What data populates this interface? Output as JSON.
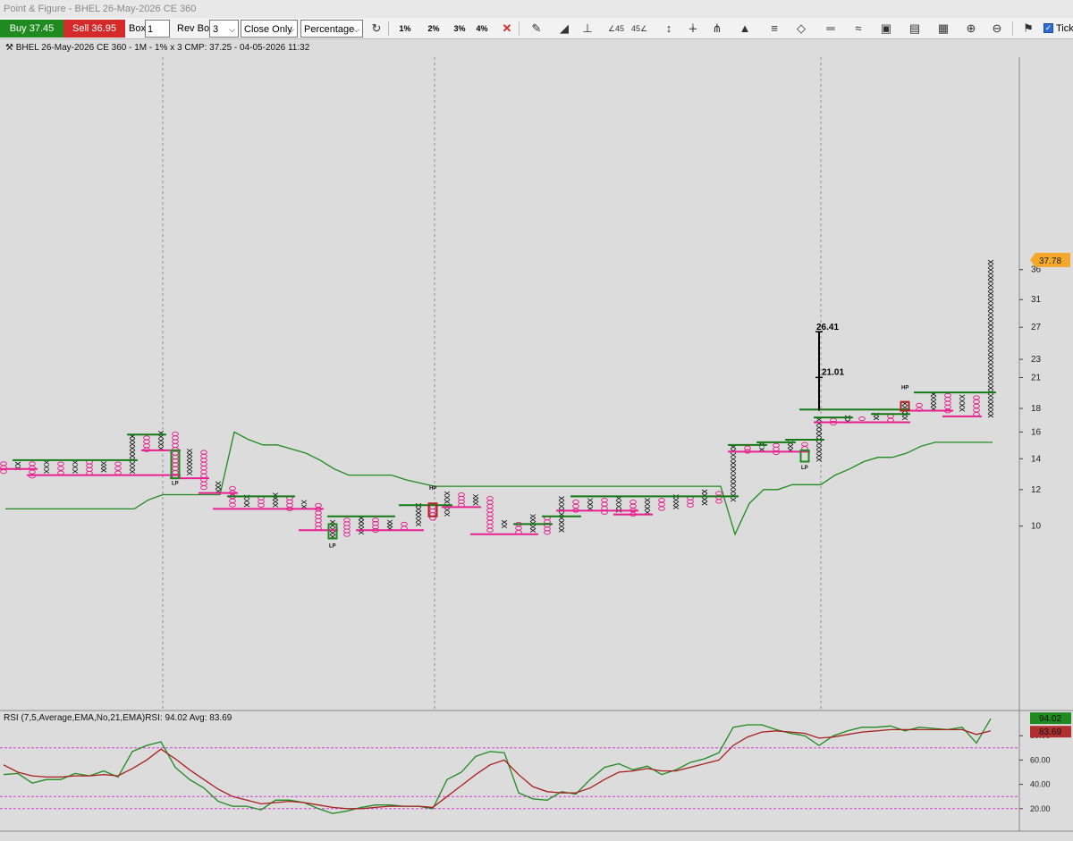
{
  "window_title": "Point & Figure - BHEL 26-May-2026 CE 360",
  "toolbar": {
    "buy_label": "Buy 37.45",
    "sell_label": "Sell 36.95",
    "box_label": "Box",
    "box_value": "1",
    "rev_box_label": "Rev Box",
    "rev_box_value": "3",
    "price_mode": "Close Only",
    "box_type": "Percentage",
    "pct_buttons": [
      "1%",
      "2%",
      "3%",
      "4%"
    ],
    "tick_label": "Tick",
    "icons": [
      "refresh-icon",
      "close-x-icon",
      "pencil-icon",
      "triangle-icon",
      "anchor-icon",
      "angle-45-left-icon",
      "angle-45-right-icon",
      "vertical-line-icon",
      "vertical-line-2-icon",
      "fork-icon",
      "megaphone-icon",
      "bars-icon",
      "diamond-icon",
      "horizontal-line-icon",
      "trend-line-icon",
      "rectangle-icon",
      "document-icon",
      "grid-icon",
      "zoom-in-icon",
      "zoom-out-icon",
      "pin-icon"
    ],
    "colors": {
      "buy": "#1f8a1f",
      "sell": "#d42a2a"
    }
  },
  "chart_data": [
    {
      "type": "point-and-figure",
      "title": "BHEL 26-May-2026 CE 360 - 1M - 1% x 3 CMP: 37.25 - 04-05-2026 11:32",
      "y_ticks": [
        10,
        12,
        14,
        16,
        18,
        21,
        23,
        27,
        31,
        36
      ],
      "last_price_label": "37.78",
      "columns": [
        {
          "kind": "O",
          "from": 13.0,
          "to": 13.8
        },
        {
          "kind": "X",
          "from": 13.2,
          "to": 13.8
        },
        {
          "kind": "O",
          "from": 12.7,
          "to": 13.8
        },
        {
          "kind": "X",
          "from": 13.0,
          "to": 13.9
        },
        {
          "kind": "O",
          "from": 12.9,
          "to": 13.8
        },
        {
          "kind": "X",
          "from": 13.0,
          "to": 13.9
        },
        {
          "kind": "O",
          "from": 12.9,
          "to": 13.9
        },
        {
          "kind": "X",
          "from": 13.1,
          "to": 13.8
        },
        {
          "kind": "O",
          "from": 12.9,
          "to": 13.8
        },
        {
          "kind": "X",
          "from": 13.0,
          "to": 15.8
        },
        {
          "kind": "O",
          "from": 14.5,
          "to": 15.7
        },
        {
          "kind": "X",
          "from": 14.6,
          "to": 16.1
        },
        {
          "kind": "O",
          "from": 12.7,
          "to": 16.0
        },
        {
          "kind": "X",
          "from": 12.9,
          "to": 14.7
        },
        {
          "kind": "O",
          "from": 12.0,
          "to": 14.6
        },
        {
          "kind": "X",
          "from": 11.8,
          "to": 12.5
        },
        {
          "kind": "O",
          "from": 11.0,
          "to": 12.2
        },
        {
          "kind": "X",
          "from": 11.0,
          "to": 11.7
        },
        {
          "kind": "O",
          "from": 11.0,
          "to": 11.6
        },
        {
          "kind": "X",
          "from": 11.0,
          "to": 11.8
        },
        {
          "kind": "O",
          "from": 10.8,
          "to": 11.6
        },
        {
          "kind": "X",
          "from": 10.9,
          "to": 11.4
        },
        {
          "kind": "O",
          "from": 9.8,
          "to": 11.2
        },
        {
          "kind": "X",
          "from": 9.4,
          "to": 10.3
        },
        {
          "kind": "O",
          "from": 9.5,
          "to": 10.4
        },
        {
          "kind": "X",
          "from": 9.6,
          "to": 10.5
        },
        {
          "kind": "O",
          "from": 9.7,
          "to": 10.4
        },
        {
          "kind": "X",
          "from": 9.8,
          "to": 10.3
        },
        {
          "kind": "O",
          "from": 9.8,
          "to": 10.2
        },
        {
          "kind": "X",
          "from": 10.0,
          "to": 11.2
        },
        {
          "kind": "O",
          "from": 10.3,
          "to": 11.1
        },
        {
          "kind": "X",
          "from": 10.5,
          "to": 11.9
        },
        {
          "kind": "O",
          "from": 11.0,
          "to": 11.8
        },
        {
          "kind": "X",
          "from": 11.1,
          "to": 11.7
        },
        {
          "kind": "O",
          "from": 9.7,
          "to": 11.6
        },
        {
          "kind": "X",
          "from": 9.9,
          "to": 10.3
        },
        {
          "kind": "O",
          "from": 9.6,
          "to": 10.2
        },
        {
          "kind": "X",
          "from": 9.7,
          "to": 10.6
        },
        {
          "kind": "O",
          "from": 9.6,
          "to": 10.5
        },
        {
          "kind": "X",
          "from": 9.7,
          "to": 11.6
        },
        {
          "kind": "O",
          "from": 10.7,
          "to": 11.4
        },
        {
          "kind": "X",
          "from": 10.8,
          "to": 11.5
        },
        {
          "kind": "O",
          "from": 10.6,
          "to": 11.5
        },
        {
          "kind": "X",
          "from": 10.7,
          "to": 11.6
        },
        {
          "kind": "O",
          "from": 10.5,
          "to": 11.4
        },
        {
          "kind": "X",
          "from": 10.6,
          "to": 11.5
        },
        {
          "kind": "O",
          "from": 10.8,
          "to": 11.5
        },
        {
          "kind": "X",
          "from": 10.9,
          "to": 11.7
        },
        {
          "kind": "O",
          "from": 11.0,
          "to": 11.6
        },
        {
          "kind": "X",
          "from": 11.1,
          "to": 12.0
        },
        {
          "kind": "O",
          "from": 11.2,
          "to": 11.9
        },
        {
          "kind": "X",
          "from": 11.3,
          "to": 15.0
        },
        {
          "kind": "O",
          "from": 14.4,
          "to": 14.9
        },
        {
          "kind": "X",
          "from": 14.5,
          "to": 15.2
        },
        {
          "kind": "O",
          "from": 14.3,
          "to": 15.1
        },
        {
          "kind": "X",
          "from": 14.5,
          "to": 15.3
        },
        {
          "kind": "O",
          "from": 14.6,
          "to": 15.2
        },
        {
          "kind": "X",
          "from": 13.8,
          "to": 17.2
        },
        {
          "kind": "O",
          "from": 16.6,
          "to": 17.1
        },
        {
          "kind": "X",
          "from": 16.7,
          "to": 17.4
        },
        {
          "kind": "O",
          "from": 16.9,
          "to": 17.3
        },
        {
          "kind": "X",
          "from": 17.0,
          "to": 17.6
        },
        {
          "kind": "O",
          "from": 16.8,
          "to": 17.5
        },
        {
          "kind": "X",
          "from": 17.0,
          "to": 18.6
        },
        {
          "kind": "O",
          "from": 17.7,
          "to": 18.5
        },
        {
          "kind": "X",
          "from": 17.8,
          "to": 19.5
        },
        {
          "kind": "O",
          "from": 17.6,
          "to": 19.4
        },
        {
          "kind": "X",
          "from": 17.7,
          "to": 19.3
        },
        {
          "kind": "O",
          "from": 17.3,
          "to": 19.2
        },
        {
          "kind": "X",
          "from": 17.2,
          "to": 37.78
        }
      ],
      "support_lines_green": [
        {
          "from": 1,
          "to": 9,
          "price": 13.9
        },
        {
          "from": 9,
          "to": 11,
          "price": 15.8
        },
        {
          "from": 16,
          "to": 20,
          "price": 11.6
        },
        {
          "from": 23,
          "to": 27,
          "price": 10.5
        },
        {
          "from": 28,
          "to": 31,
          "price": 11.1
        },
        {
          "from": 36,
          "to": 38,
          "price": 10.1
        },
        {
          "from": 38,
          "to": 40,
          "price": 10.5
        },
        {
          "from": 40,
          "to": 51,
          "price": 11.6
        },
        {
          "from": 51,
          "to": 53,
          "price": 15.0
        },
        {
          "from": 53,
          "to": 55,
          "price": 15.2
        },
        {
          "from": 55,
          "to": 57,
          "price": 15.4
        },
        {
          "from": 57,
          "to": 59,
          "price": 17.2
        },
        {
          "from": 56,
          "to": 63,
          "price": 17.9
        },
        {
          "from": 61,
          "to": 63,
          "price": 17.5
        },
        {
          "from": 64,
          "to": 69,
          "price": 19.5
        }
      ],
      "resistance_lines_pink": [
        {
          "from": 0,
          "to": 2,
          "price": 13.3
        },
        {
          "from": 2,
          "to": 12,
          "price": 12.9
        },
        {
          "from": 10,
          "to": 12,
          "price": 14.6
        },
        {
          "from": 12,
          "to": 14,
          "price": 12.7
        },
        {
          "from": 14,
          "to": 16,
          "price": 11.8
        },
        {
          "from": 15,
          "to": 22,
          "price": 10.9
        },
        {
          "from": 21,
          "to": 23,
          "price": 9.8
        },
        {
          "from": 25,
          "to": 29,
          "price": 9.8
        },
        {
          "from": 31,
          "to": 33,
          "price": 11.0
        },
        {
          "from": 33,
          "to": 37,
          "price": 9.6
        },
        {
          "from": 39,
          "to": 44,
          "price": 10.8
        },
        {
          "from": 43,
          "to": 45,
          "price": 10.6
        },
        {
          "from": 51,
          "to": 56,
          "price": 14.5
        },
        {
          "from": 57,
          "to": 63,
          "price": 16.8
        },
        {
          "from": 63,
          "to": 66,
          "price": 17.8
        },
        {
          "from": 66,
          "to": 68,
          "price": 17.3
        }
      ],
      "pattern_boxes": [
        {
          "col": 12,
          "from": 12.7,
          "to": 14.6,
          "color": "#1f8a1f"
        },
        {
          "col": 23,
          "from": 9.4,
          "to": 10.1,
          "color": "#1f8a1f"
        },
        {
          "col": 30,
          "from": 10.5,
          "to": 11.2,
          "color": "#b22222"
        },
        {
          "col": 56,
          "from": 13.8,
          "to": 14.6,
          "color": "#1f8a1f"
        },
        {
          "col": 63,
          "from": 17.8,
          "to": 18.6,
          "color": "#b22222"
        }
      ],
      "moving_average": [
        {
          "x": 0,
          "price": 10.9
        },
        {
          "x": 9,
          "price": 10.9
        },
        {
          "x": 10,
          "price": 11.4
        },
        {
          "x": 11,
          "price": 11.7
        },
        {
          "x": 15,
          "price": 11.7
        },
        {
          "x": 16,
          "price": 16.0
        },
        {
          "x": 17,
          "price": 15.4
        },
        {
          "x": 18,
          "price": 15.0
        },
        {
          "x": 19,
          "price": 15.0
        },
        {
          "x": 20,
          "price": 14.7
        },
        {
          "x": 21,
          "price": 14.4
        },
        {
          "x": 22,
          "price": 13.9
        },
        {
          "x": 23,
          "price": 13.3
        },
        {
          "x": 24,
          "price": 12.9
        },
        {
          "x": 27,
          "price": 12.9
        },
        {
          "x": 28,
          "price": 12.6
        },
        {
          "x": 29,
          "price": 12.4
        },
        {
          "x": 30,
          "price": 12.2
        },
        {
          "x": 50,
          "price": 12.2
        },
        {
          "x": 51,
          "price": 9.6
        },
        {
          "x": 52,
          "price": 11.2
        },
        {
          "x": 53,
          "price": 12.0
        },
        {
          "x": 54,
          "price": 12.0
        },
        {
          "x": 55,
          "price": 12.3
        },
        {
          "x": 57,
          "price": 12.3
        },
        {
          "x": 58,
          "price": 12.9
        },
        {
          "x": 59,
          "price": 13.3
        },
        {
          "x": 60,
          "price": 13.8
        },
        {
          "x": 61,
          "price": 14.1
        },
        {
          "x": 62,
          "price": 14.1
        },
        {
          "x": 63,
          "price": 14.4
        },
        {
          "x": 64,
          "price": 14.9
        },
        {
          "x": 65,
          "price": 15.2
        },
        {
          "x": 69,
          "price": 15.2
        }
      ],
      "annotations": [
        {
          "text": "LP",
          "col": 12,
          "price": 12.3
        },
        {
          "text": "LP",
          "col": 23,
          "price": 9.0
        },
        {
          "text": "HP",
          "col": 30,
          "price": 12.0
        },
        {
          "text": "LP",
          "col": 56,
          "price": 13.3
        },
        {
          "text": "HP",
          "col": 63,
          "price": 19.8
        }
      ],
      "target_measure": {
        "col": 57,
        "from": 17.8,
        "mid": 21.01,
        "to": 26.41,
        "mid_label": "21.01",
        "top_label": "26.41"
      },
      "vertical_gridlines_cols": [
        11,
        30,
        57
      ]
    },
    {
      "type": "line",
      "title": "RSI (7,5,Average,EMA,No,21,EMA)RSI: 94.02 Avg: 83.69",
      "ylim": [
        0,
        100
      ],
      "y_ticks": [
        "20.00",
        "40.00",
        "60.00",
        "80.00"
      ],
      "levels": [
        20,
        30,
        70
      ],
      "last_labels": {
        "rsi": "94.02",
        "avg": "83.69"
      },
      "series": [
        {
          "color": "#1f8a1f",
          "values": [
            48,
            49,
            41,
            44,
            44,
            49,
            47,
            51,
            46,
            67,
            72,
            75,
            54,
            44,
            37,
            26,
            22,
            22,
            19,
            27,
            27,
            25,
            20,
            16,
            18,
            21,
            23,
            23,
            22,
            22,
            20,
            44,
            50,
            63,
            67,
            66,
            33,
            28,
            27,
            34,
            32,
            44,
            54,
            57,
            52,
            55,
            48,
            52,
            58,
            61,
            66,
            87,
            89,
            89,
            85,
            82,
            80,
            72,
            80,
            84,
            87,
            87,
            88,
            84,
            87,
            86,
            85,
            87,
            74,
            94
          ]
        },
        {
          "color": "#a82020",
          "values": [
            56,
            50,
            47,
            46,
            46,
            47,
            47,
            48,
            47,
            53,
            60,
            69,
            61,
            52,
            44,
            36,
            30,
            27,
            24,
            25,
            26,
            25,
            23,
            21,
            20,
            20,
            21,
            22,
            22,
            22,
            21,
            30,
            39,
            48,
            56,
            60,
            48,
            38,
            34,
            33,
            33,
            37,
            44,
            50,
            51,
            53,
            51,
            51,
            54,
            57,
            60,
            72,
            79,
            83,
            84,
            83,
            82,
            78,
            79,
            81,
            83,
            84,
            85,
            85,
            85,
            85,
            85,
            85,
            81,
            84
          ]
        }
      ]
    }
  ]
}
